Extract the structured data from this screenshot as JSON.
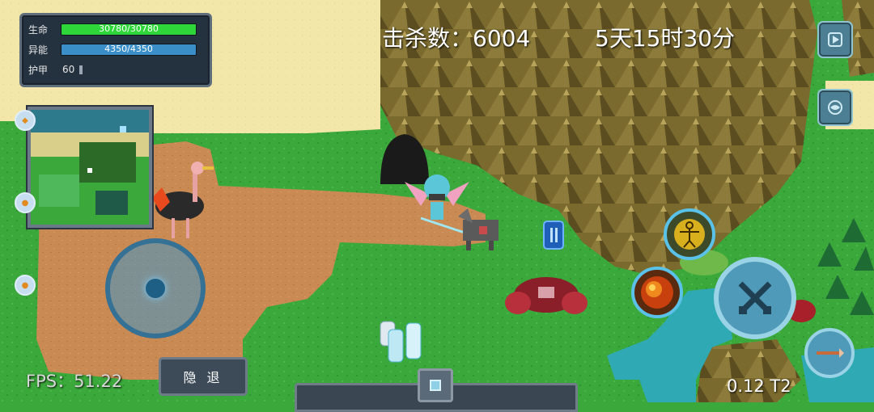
{
  "status": {
    "hp_label": "生命",
    "hp_text": "30780/30780",
    "hp_fraction": 1.0,
    "energy_label": "异能",
    "energy_text": "4350/4350",
    "energy_fraction": 1.0,
    "armor_label": "护甲",
    "armor_value": "60"
  },
  "hud": {
    "kills": "击杀数：6004",
    "time": "5天15时30分",
    "fps": "FPS：51.22",
    "version": "0.12 T2"
  },
  "buttons": {
    "hide_label": "隐 退"
  },
  "colors": {
    "hp_bar": "#2fd63a",
    "energy_bar": "#3a8fc9",
    "grass": "#3aa83a",
    "sand": "#f1e6a6",
    "dirt": "#c98a53",
    "water": "#2fa9b3"
  }
}
